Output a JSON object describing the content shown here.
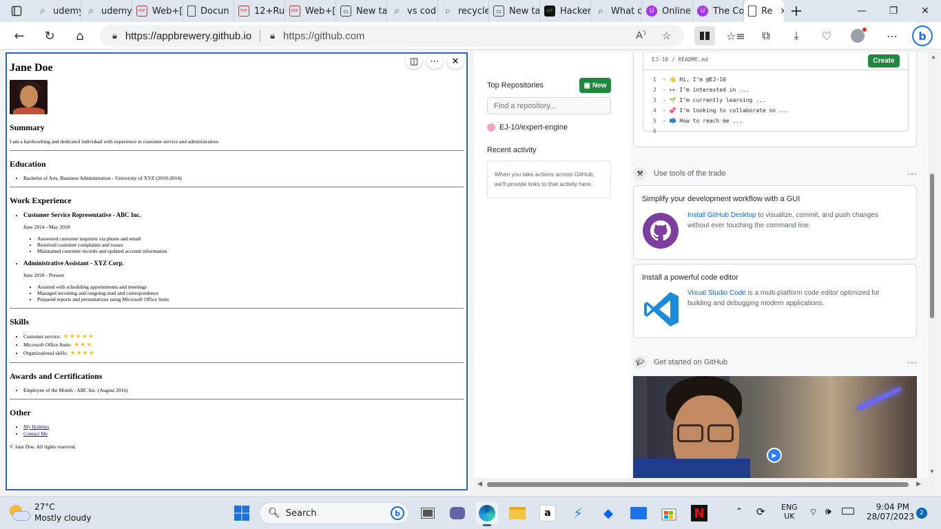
{
  "tabs": [
    {
      "label": "udemy",
      "icon": "search-icon"
    },
    {
      "label": "udemy",
      "icon": "search-icon"
    },
    {
      "label": "Web+[",
      "icon": "pdf-icon"
    },
    {
      "label": "Docun",
      "icon": "document-icon"
    },
    {
      "label": "12+Ru",
      "icon": "pdf-icon"
    },
    {
      "label": "Web+[",
      "icon": "pdf-icon"
    },
    {
      "label": "New ta",
      "icon": "newtab-icon"
    },
    {
      "label": "vs cod",
      "icon": "search-icon"
    },
    {
      "label": "recycle",
      "icon": "search-icon"
    },
    {
      "label": "New ta",
      "icon": "newtab-icon"
    },
    {
      "label": "Hacker",
      "icon": "hackerrank-icon"
    },
    {
      "label": "What c",
      "icon": "search-icon"
    },
    {
      "label": "Online",
      "icon": "udemy-icon"
    },
    {
      "label": "The Co",
      "icon": "udemy-icon"
    },
    {
      "label": "Re",
      "icon": "document-icon",
      "active": true
    }
  ],
  "address": {
    "url_left": "https://appbrewery.github.io",
    "url_right": "https://github.com"
  },
  "resume": {
    "name": "Jane Doe",
    "summary_heading": "Summary",
    "summary": "I am a hardworking and dedicated individual with experience in customer service and administration.",
    "education_heading": "Education",
    "education": [
      "Bachelor of Arts, Business Administration - University of XYZ (2010-2014)"
    ],
    "work_heading": "Work Experience",
    "jobs": [
      {
        "title": "Customer Service Representative - ABC Inc.",
        "dates": "June 2014 - May 2018",
        "duties": [
          "Answered customer inquiries via phone and email",
          "Resolved customer complaints and issues",
          "Maintained customer records and updated account information"
        ]
      },
      {
        "title": "Administrative Assistant - XYZ Corp.",
        "dates": "June 2018 - Present",
        "duties": [
          "Assisted with scheduling appointments and meetings",
          "Managed incoming and outgoing mail and correspondence",
          "Prepared reports and presentations using Microsoft Office Suite"
        ]
      }
    ],
    "skills_heading": "Skills",
    "skills": [
      {
        "label": "Customer service:",
        "stars": 5
      },
      {
        "label": "Microsoft Office Suite:",
        "stars": 3
      },
      {
        "label": "Organizational skills:",
        "stars": 4
      }
    ],
    "awards_heading": "Awards and Certifications",
    "awards": [
      "Employee of the Month - ABC Inc. (August 2016)"
    ],
    "other_heading": "Other",
    "links": [
      "My Hobbies",
      "Contact Me"
    ],
    "copyright": "© Jane Doe. All rights reserved."
  },
  "github": {
    "top_repos_heading": "Top Repositories",
    "new_button": "New",
    "find_placeholder": "Find a repository...",
    "repo": "EJ-10/expert-engine",
    "recent_heading": "Recent activity",
    "recent_text": "When you take actions across GitHub, we'll provide links to that activity here.",
    "readme_path": "EJ-10 / README.md",
    "create_button": "Create",
    "readme_lines": [
      {
        "n": "1",
        "text": "- 👋 Hi, I’m @EJ-10"
      },
      {
        "n": "2",
        "text": "- 👀 I’m interested in ..."
      },
      {
        "n": "3",
        "text": "- 🌱 I’m currently learning ..."
      },
      {
        "n": "4",
        "text": "- 💞️ I’m looking to collaborate on ..."
      },
      {
        "n": "5",
        "text": "- 📫 How to reach me ..."
      },
      {
        "n": "6",
        "text": ""
      }
    ],
    "tools_heading": "Use tools of the trade",
    "gui_title": "Simplify your development workflow with a GUI",
    "gui_link": "Install GitHub Desktop",
    "gui_text": " to visualize, commit, and push changes without ever touching the command line.",
    "editor_title": "Install a powerful code editor",
    "editor_link": "Visual Studio Code",
    "editor_text": " is a multi-platform code editor optimized for building and debugging modern applications.",
    "started_heading": "Get started on GitHub"
  },
  "taskbar": {
    "temp": "27°C",
    "weather": "Mostly cloudy",
    "search": "Search",
    "lang1": "ENG",
    "lang2": "UK",
    "time": "9:04 PM",
    "date": "28/07/2023",
    "notif": "2"
  },
  "colors": {
    "accent": "#2b64c9",
    "github_green": "#1f883d",
    "link": "#0969da"
  }
}
